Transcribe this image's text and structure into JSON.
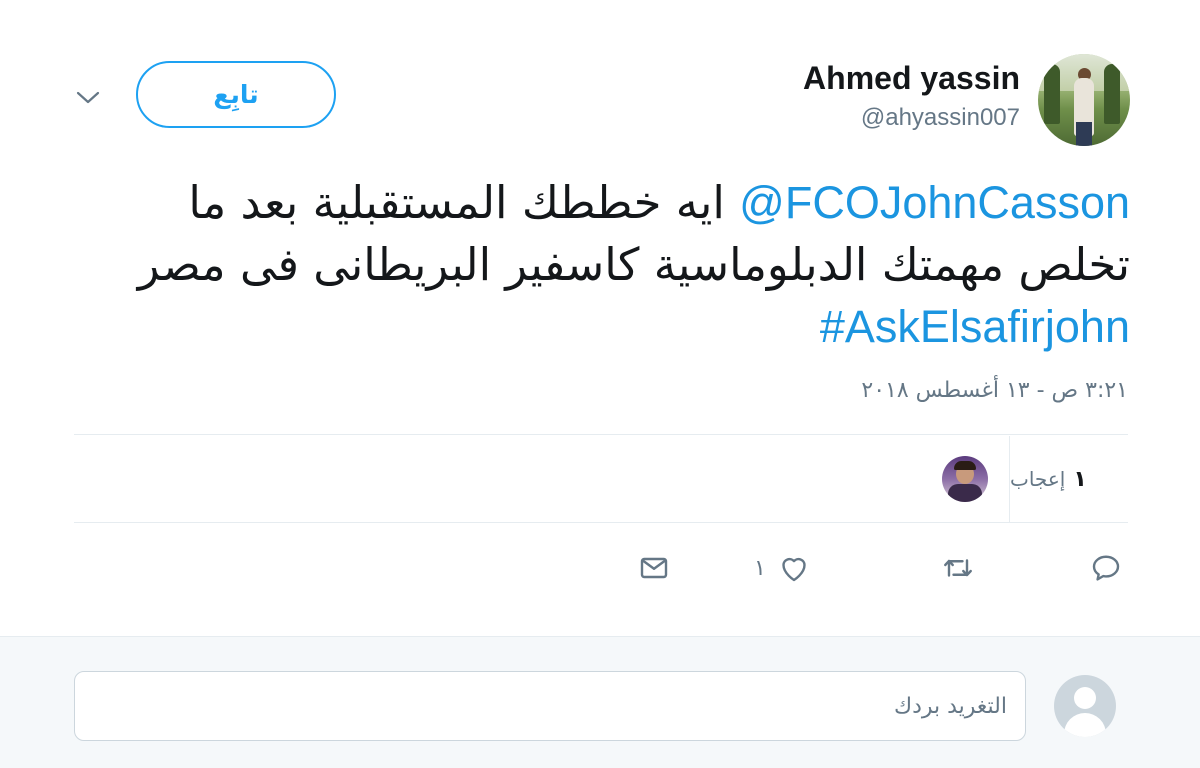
{
  "user": {
    "name": "Ahmed yassin",
    "handle": "@ahyassin007"
  },
  "follow_label": "تابِع",
  "tweet": {
    "mention": "@FCOJohnCasson",
    "text_part1": " ايه خططك المستقبلية بعد ما تخلص مهمتك الدبلوماسية كاسفير  البريطانى فى مصر ",
    "hashtag": "#AskElsafirjohn",
    "timestamp": "٣:٢١ ص - ١٣ أغسطس ٢٠١٨"
  },
  "stats": {
    "likes_count": "١",
    "likes_label": "إعجاب"
  },
  "actions": {
    "like_count": "١"
  },
  "reply": {
    "placeholder": "التغريد بردك"
  },
  "colors": {
    "accent": "#1da1f2",
    "link": "#1b95e0",
    "muted": "#657786",
    "divider": "#e6ecf0",
    "reply_bg": "#f5f8fa"
  },
  "icons": [
    "chevron-down-icon",
    "reply-icon",
    "retweet-icon",
    "like-icon",
    "message-icon",
    "default-avatar-icon"
  ]
}
